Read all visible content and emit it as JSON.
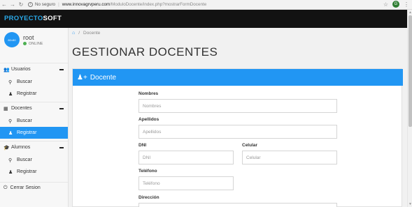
{
  "browser": {
    "security_label": "No seguro",
    "url_host": "www.innovagrvperu.com",
    "url_path": "/ModuloDocente/index.php?mostrarFormDocente",
    "profile_initial": "G"
  },
  "app": {
    "brand_part1": "PROYECTO",
    "brand_part2": "SOFT"
  },
  "user": {
    "avatar_text": "80×80",
    "name": "root",
    "status": "ONLINE"
  },
  "sidebar": {
    "groups": [
      {
        "label": "Usuarios",
        "items": [
          {
            "label": "Buscar"
          },
          {
            "label": "Registrar"
          }
        ]
      },
      {
        "label": "Docentes",
        "items": [
          {
            "label": "Buscar"
          },
          {
            "label": "Registrar"
          }
        ]
      },
      {
        "label": "Alumnos",
        "items": [
          {
            "label": "Buscar"
          },
          {
            "label": "Registrar"
          }
        ]
      }
    ],
    "logout_label": "Cerrar Sesion"
  },
  "main": {
    "breadcrumb": "Docente",
    "title": "GESTIONAR DOCENTES",
    "panel_title": "Docente"
  },
  "form": {
    "nombres_label": "Nombres",
    "nombres_placeholder": "Nombres",
    "apellidos_label": "Apellidos",
    "apellidos_placeholder": "Apellidos",
    "dni_label": "DNI",
    "dni_placeholder": "DNI",
    "celular_label": "Celular",
    "celular_placeholder": "Celular",
    "telefono_label": "Teléfono",
    "telefono_placeholder": "Teléfono",
    "direccion_label": "Dirección"
  },
  "icons": {
    "accent": "#2196f3",
    "topbar": "#121212"
  }
}
